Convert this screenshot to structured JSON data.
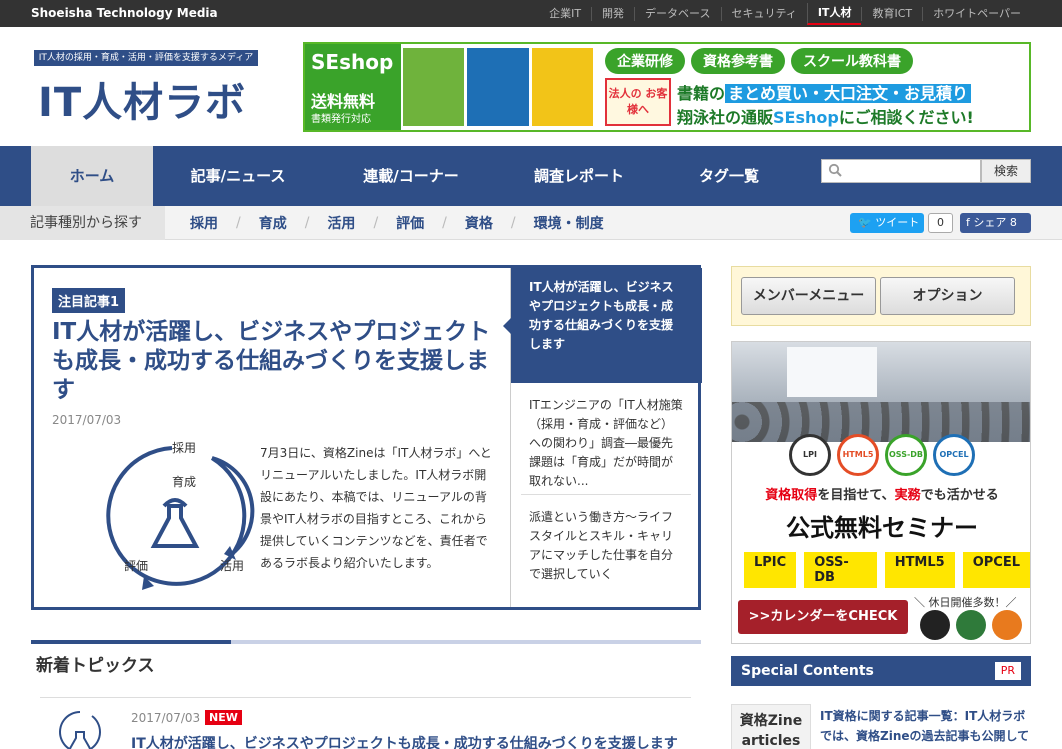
{
  "topbar": {
    "brand": "Shoeisha Technology Media",
    "sites": [
      "企業IT",
      "開発",
      "データベース",
      "セキュリティ",
      "IT人材",
      "教育ICT",
      "ホワイトペーパー"
    ]
  },
  "header": {
    "tagline": "IT人材の採用・育成・活用・評価を支援するメディア",
    "logo": "IT人材ラボ"
  },
  "banner": {
    "shop_logo": "SEshop",
    "free_shipping": "送料無料",
    "invoice": "書類発行対応",
    "pills": [
      "企業研修",
      "資格参考書",
      "スクール教科書"
    ],
    "corporate": "法人の お客様へ",
    "msg_prefix": "書籍の",
    "msg_highlight": "まとめ買い・大口注文・お見積り",
    "msg_line2_a": "翔泳社の通販",
    "msg_line2_b": "SEshop",
    "msg_line2_c": "にご相談ください!"
  },
  "nav": {
    "items": [
      "ホーム",
      "記事/ニュース",
      "連載/コーナー",
      "調査レポート",
      "タグ一覧"
    ],
    "search_button": "検索",
    "search_placeholder": ""
  },
  "categories": {
    "lead": "記事種別から探す",
    "items": [
      "採用",
      "育成",
      "活用",
      "評価",
      "資格",
      "環境・制度"
    ]
  },
  "social": {
    "tweet": "ツイート",
    "tweet_count": "0",
    "share": "シェア 8"
  },
  "featured": {
    "badge": "注目記事1",
    "title": "IT人材が活躍し、ビジネスやプロジェクトも成長・成功する仕組みづくりを支援します",
    "date": "2017/07/03",
    "body": "7月3日に、資格Zineは「IT人材ラボ」へとリニューアルいたしました。IT人材ラボ開設にあたり、本稿では、リニューアルの背景やIT人材ラボの目指すところ、これから提供していくコンテンツなどを、責任者であるラボ長より紹介いたします。",
    "diagram": {
      "recruit": "採用",
      "train": "育成",
      "utilize": "活用",
      "evaluate": "評価"
    },
    "side": [
      "IT人材が活躍し、ビジネスやプロジェクトも成長・成功する仕組みづくりを支援します",
      "ITエンジニアの「IT人材施策（採用・育成・評価など）への関わり」調査―最優先課題は「育成」だが時間が取れない...",
      "派遣という働き方～ライフスタイルとスキル・キャリアにマッチした仕事を自分で選択していく"
    ]
  },
  "topics": {
    "title": "新着トピックス",
    "date": "2017/07/03",
    "new_label": "NEW",
    "link": "IT人材が活躍し、ビジネスやプロジェクトも成長・成功する仕組みづくりを支援します"
  },
  "sidebar": {
    "member_menu": "メンバーメニュー",
    "options": "オプション",
    "ad": {
      "logos": [
        "LPI",
        "HTML5",
        "OSS-DB",
        "OPCEL"
      ],
      "line1_a": "資格取得",
      "line1_b": "を目指せて、",
      "line1_c": "実務",
      "line1_d": "でも活かせる",
      "line2": "公式無料セミナー",
      "tags": [
        "LPIC",
        "OSS-DB",
        "HTML5",
        "OPCEL"
      ],
      "check": ">>カレンダーをCHECK",
      "holiday": "＼ 休日開催多数！／"
    },
    "special_title": "Special Contents",
    "pr": "PR",
    "zine_label": "資格Zine articles",
    "zine_link": "IT資格に関する記事一覧：IT人材ラボでは、資格Zineの過去記事も公開しております"
  },
  "colors": {
    "brand_navy": "#2f4e87",
    "accent_red": "#e60012",
    "seshop_green": "#3aa32a"
  }
}
